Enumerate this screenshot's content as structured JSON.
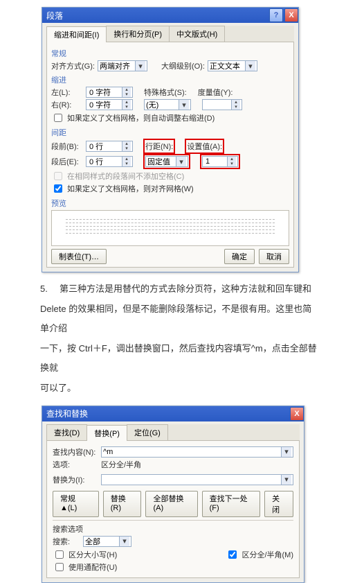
{
  "paragraph_dialog": {
    "title": "段落",
    "help": "?",
    "close": "X",
    "tabs": [
      "缩进和间距(I)",
      "换行和分页(P)",
      "中文版式(H)"
    ],
    "group_general": "常规",
    "align_label": "对齐方式(G):",
    "align_value": "两端对齐",
    "outline_label": "大纲级别(O):",
    "outline_value": "正文文本",
    "group_indent": "缩进",
    "left_label": "左(L):",
    "left_value": "0 字符",
    "right_label": "右(R):",
    "right_value": "0 字符",
    "special_label": "特殊格式(S):",
    "special_value": "(无)",
    "measure_label": "度量值(Y):",
    "measure_value": "",
    "chk1": "如果定义了文档网格，则自动调整右缩进(D)",
    "group_spacing": "间距",
    "before_label": "段前(B):",
    "before_value": "0 行",
    "after_label": "段后(E):",
    "after_value": "0 行",
    "linespace_label": "行距(N):",
    "linespace_value": "固定值",
    "setat_label": "设置值(A):",
    "setat_value": "1",
    "chk2_dim": "在相同样式的段落间不添加空格(C)",
    "chk3": "如果定义了文档网格，则对齐网格(W)",
    "preview_label": "预览",
    "tabs_btn": "制表位(T)…",
    "ok": "确定",
    "cancel": "取消"
  },
  "maintext": {
    "num": "5.",
    "line1": "第三种方法是用替代的方式去除分页符，这种方法就和回车键和",
    "line2": "Delete 的效果相同，但是不能删除段落标记，不是很有用。这里也简单介绍",
    "line3": "一下，按 Ctrl＋F，调出替换窗口，然后查找内容填写^m，点击全部替换就",
    "line4": "可以了。"
  },
  "replace_dialog": {
    "title": "查找和替换",
    "close": "X",
    "tabs": [
      "查找(D)",
      "替换(P)",
      "定位(G)"
    ],
    "find_label": "查找内容(N):",
    "find_value": "^m",
    "options_label": "选项:",
    "options_value": "区分全/半角",
    "replace_label": "替换为(I):",
    "replace_value": "",
    "less_btn": "常规 ▲(L)",
    "replace_btn": "替换(R)",
    "replace_all_btn": "全部替换(A)",
    "find_next_btn": "查找下一处(F)",
    "cancel_btn": "关闭",
    "search_section": "搜索选项",
    "search_label": "搜索:",
    "search_value": "全部",
    "chk_case": "区分大小写(H)",
    "chk_width": "区分全/半角(M)",
    "chk_wildcard": "使用通配符(U)"
  }
}
